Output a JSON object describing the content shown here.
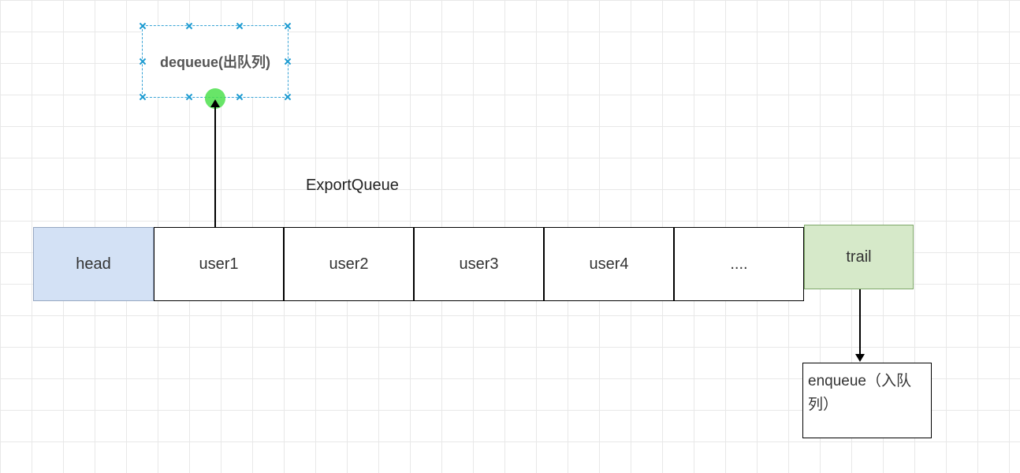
{
  "dequeue": {
    "label": "dequeue(出队列)"
  },
  "queue_title": "ExportQueue",
  "queue": {
    "head": "head",
    "cells": [
      "user1",
      "user2",
      "user3",
      "user4",
      "...."
    ],
    "trail": "trail"
  },
  "enqueue": {
    "label": "enqueue（入队列）"
  }
}
